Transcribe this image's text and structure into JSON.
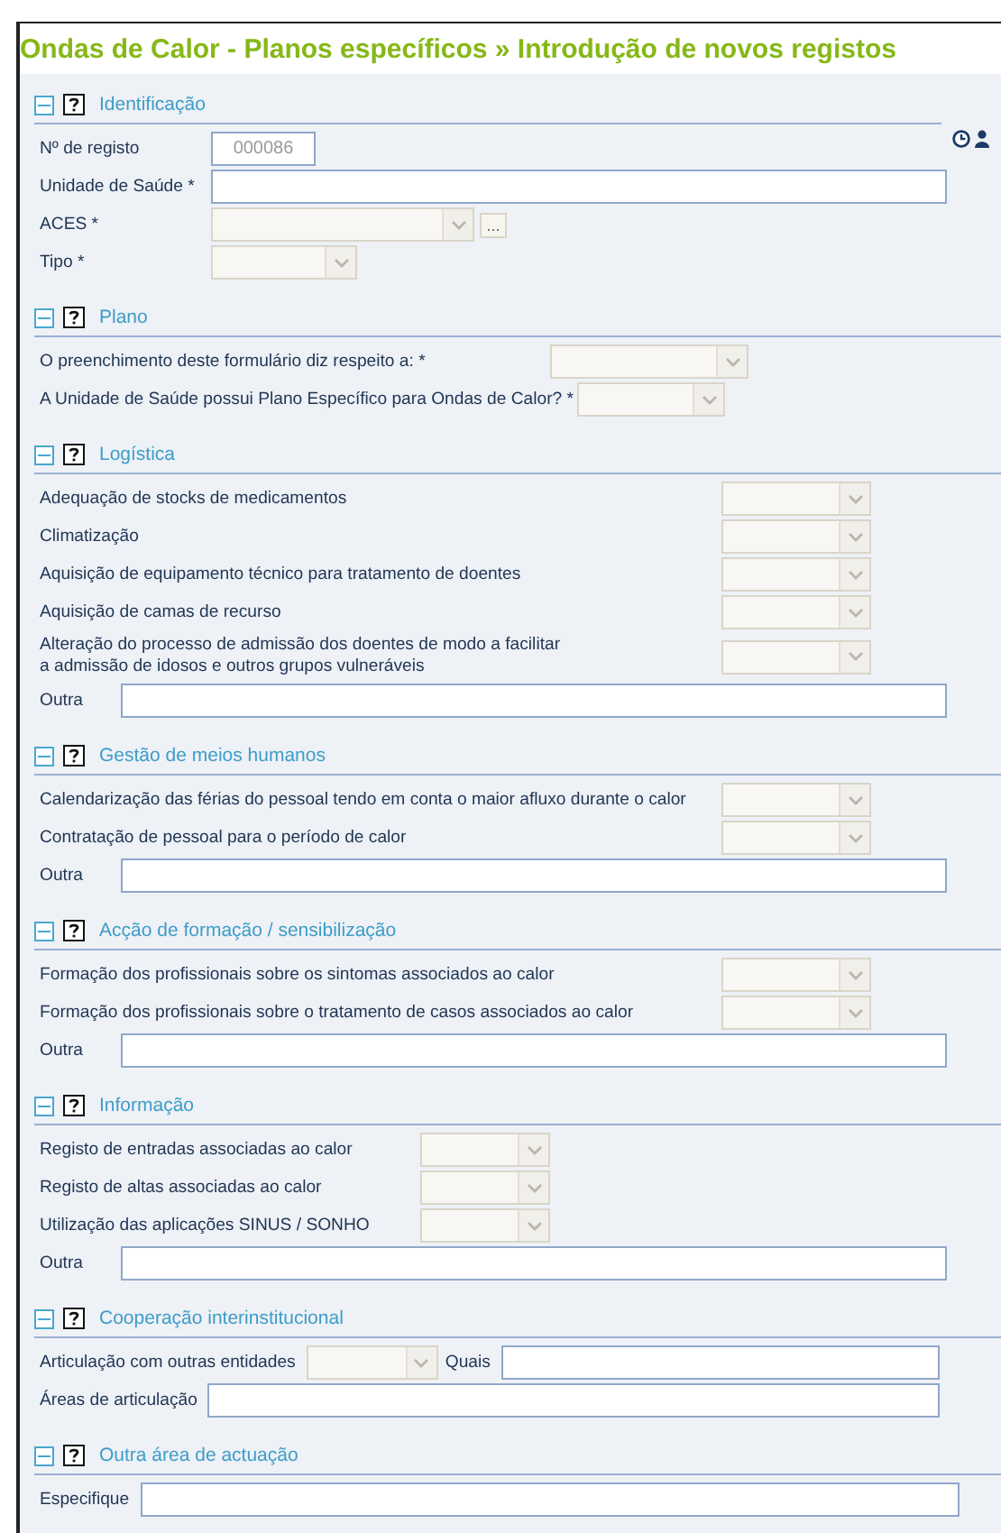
{
  "title": "Ondas de Calor - Planos específicos » Introdução de novos registos",
  "sections": [
    {
      "title": "Identificação",
      "expanded": true,
      "rows": [
        {
          "label": "Nº de registo",
          "control": {
            "kind": "readonly",
            "value": "000086"
          }
        },
        {
          "label": "Unidade de Saúde *",
          "control": {
            "kind": "text"
          }
        },
        {
          "label": "ACES *",
          "control": {
            "kind": "select_more",
            "button": "..."
          }
        },
        {
          "label": "Tipo *",
          "control": {
            "kind": "select"
          }
        }
      ]
    },
    {
      "title": "Plano",
      "expanded": true,
      "rows": [
        {
          "label": "O preenchimento deste formulário diz respeito a: *",
          "control": {
            "kind": "select"
          }
        },
        {
          "label": "A Unidade de Saúde possui Plano Específico para Ondas de Calor? *",
          "control": {
            "kind": "select"
          }
        }
      ]
    },
    {
      "title": "Logística",
      "expanded": true,
      "rows": [
        {
          "label": "Adequação de stocks de medicamentos",
          "control": {
            "kind": "select"
          }
        },
        {
          "label": "Climatização",
          "control": {
            "kind": "select"
          }
        },
        {
          "label": "Aquisição de equipamento técnico para tratamento de doentes",
          "control": {
            "kind": "select"
          }
        },
        {
          "label": "Aquisição de camas de recurso",
          "control": {
            "kind": "select"
          }
        },
        {
          "label": "Alteração do processo de admissão dos doentes de modo a facilitar\na admissão de idosos e outros grupos vulneráveis",
          "control": {
            "kind": "select"
          }
        },
        {
          "label": "Outra",
          "control": {
            "kind": "text"
          }
        }
      ]
    },
    {
      "title": "Gestão de meios humanos",
      "expanded": true,
      "rows": [
        {
          "label": "Calendarização das férias do pessoal tendo em conta o maior afluxo durante o calor",
          "control": {
            "kind": "select"
          }
        },
        {
          "label": "Contratação de pessoal para o período de calor",
          "control": {
            "kind": "select"
          }
        },
        {
          "label": "Outra",
          "control": {
            "kind": "text"
          }
        }
      ]
    },
    {
      "title": "Acção de formação / sensibilização",
      "expanded": true,
      "rows": [
        {
          "label": "Formação dos profissionais sobre os sintomas associados ao calor",
          "control": {
            "kind": "select"
          }
        },
        {
          "label": "Formação dos profissionais sobre o tratamento de casos associados ao calor",
          "control": {
            "kind": "select"
          }
        },
        {
          "label": "Outra",
          "control": {
            "kind": "text"
          }
        }
      ]
    },
    {
      "title": "Informação",
      "expanded": true,
      "rows": [
        {
          "label": "Registo de entradas associadas ao calor",
          "control": {
            "kind": "select"
          }
        },
        {
          "label": "Registo de altas associadas ao calor",
          "control": {
            "kind": "select"
          }
        },
        {
          "label": "Utilização das aplicações SINUS / SONHO",
          "control": {
            "kind": "select"
          }
        },
        {
          "label": "Outra",
          "control": {
            "kind": "text"
          }
        }
      ]
    },
    {
      "title": "Cooperação interinstitucional",
      "expanded": true,
      "rows": [
        {
          "label": "Articulação com outras entidades",
          "control": {
            "kind": "select"
          },
          "extra": {
            "label": "Quais",
            "control": {
              "kind": "text"
            }
          }
        },
        {
          "label": "Áreas de articulação",
          "control": {
            "kind": "text"
          }
        }
      ]
    },
    {
      "title": "Outra área de actuação",
      "expanded": true,
      "rows": [
        {
          "label": "Especifique",
          "control": {
            "kind": "text"
          }
        }
      ]
    }
  ]
}
